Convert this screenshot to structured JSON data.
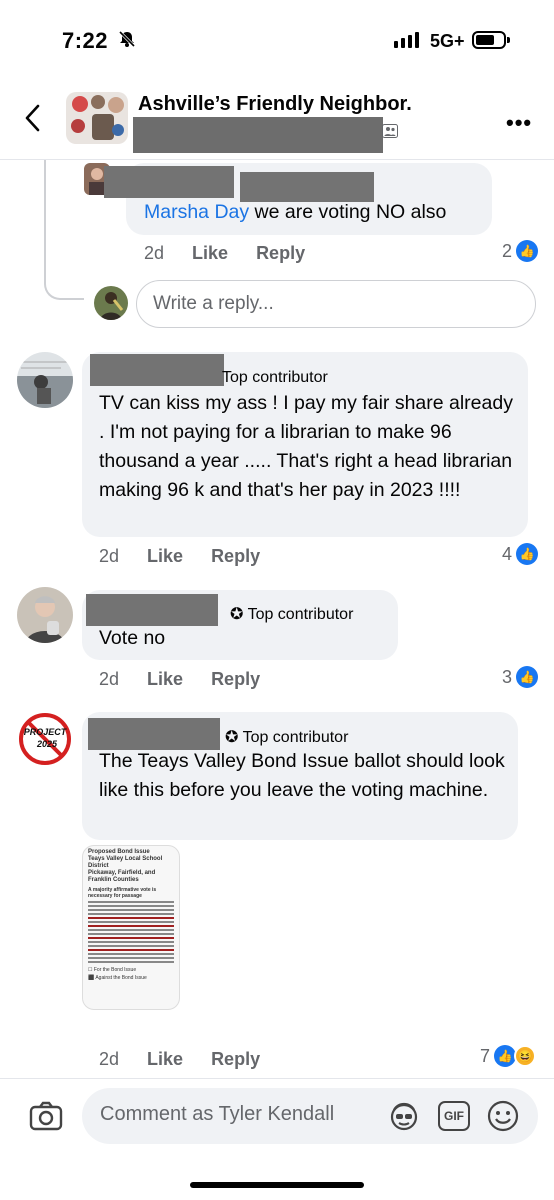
{
  "status_bar": {
    "time": "7:22",
    "network": "5G+"
  },
  "header": {
    "group_name": "Ashville’s Friendly Neighbor."
  },
  "comments": [
    {
      "id": "reply-1",
      "mention": "Marsha Day",
      "text": " we are voting NO also",
      "time": "2d",
      "like": "Like",
      "reply": "Reply",
      "reactions": "2"
    },
    {
      "id": "comment-1",
      "badge": "Top contributor",
      "text": "TV can kiss my ass ! I pay my fair share already . I'm not paying for a librarian to make 96 thousand a year ..... That's right a head librarian making 96 k and that's her pay in 2023 !!!!",
      "time": "2d",
      "like": "Like",
      "reply": "Reply",
      "reactions": "4"
    },
    {
      "id": "comment-2",
      "badge": "Top contributor",
      "text": "Vote no",
      "time": "2d",
      "like": "Like",
      "reply": "Reply",
      "reactions": "3"
    },
    {
      "id": "comment-3",
      "badge": "Top contributor",
      "text": "The Teays Valley Bond Issue ballot should look like this before you leave the voting machine.",
      "time": "2d",
      "like": "Like",
      "reply": "Reply",
      "reactions": "7"
    }
  ],
  "reply_placeholder": "Write a reply...",
  "avatar_text": {
    "project": "PROJECT",
    "year": "2025"
  },
  "ballot": {
    "title": "Proposed Bond Issue",
    "district": "Teays Valley Local School District",
    "counties": "Pickaway, Fairfield, and Franklin Counties",
    "majority": "A majority affirmative vote is necessary for passage",
    "option_for": "For the Bond Issue",
    "option_against": "Against the Bond Issue"
  },
  "composer": {
    "placeholder": "Comment as Tyler Kendall",
    "gif_label": "GIF"
  },
  "colors": {
    "link": "#1b74e4",
    "like": "#1877f2",
    "bubble": "#f0f2f5",
    "redaction": "#737373"
  }
}
